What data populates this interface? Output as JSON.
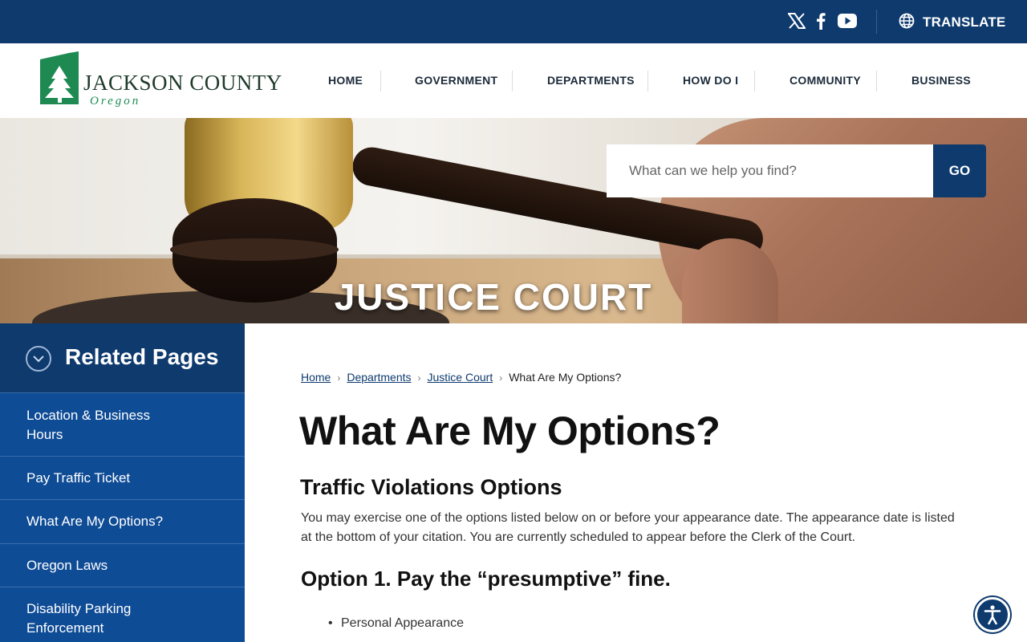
{
  "topbar": {
    "social": [
      {
        "name": "x-icon",
        "label": "X"
      },
      {
        "name": "facebook-icon",
        "label": "Facebook"
      },
      {
        "name": "youtube-icon",
        "label": "YouTube"
      }
    ],
    "translate_label": "TRANSLATE"
  },
  "header": {
    "logo_name": "JACKSON COUNTY",
    "logo_sub": "Oregon",
    "nav": [
      "HOME",
      "GOVERNMENT",
      "DEPARTMENTS",
      "HOW DO I",
      "COMMUNITY",
      "BUSINESS"
    ]
  },
  "hero": {
    "title": "JUSTICE COURT",
    "search_placeholder": "What can we help you find?",
    "search_button": "GO"
  },
  "sidebar": {
    "title": "Related Pages",
    "items": [
      "Location & Business Hours",
      "Pay Traffic Ticket",
      "What Are My Options?",
      "Oregon Laws",
      "Disability Parking Enforcement"
    ]
  },
  "breadcrumb": {
    "links": [
      "Home",
      "Departments",
      "Justice Court"
    ],
    "current": "What Are My Options?"
  },
  "content": {
    "page_title": "What Are My Options?",
    "section_title": "Traffic Violations Options",
    "paragraph": "You may exercise one of the options listed below on or before your appearance date. The appearance date is listed at the bottom of your citation. You are currently scheduled to appear before the Clerk of the Court.",
    "option_heading": "Option 1. Pay the “presumptive” fine.",
    "bullets": [
      "Personal Appearance"
    ]
  },
  "colors": {
    "primary": "#0e3a6e",
    "sidebar": "#0f4c96",
    "logo_green": "#1e8a52"
  }
}
